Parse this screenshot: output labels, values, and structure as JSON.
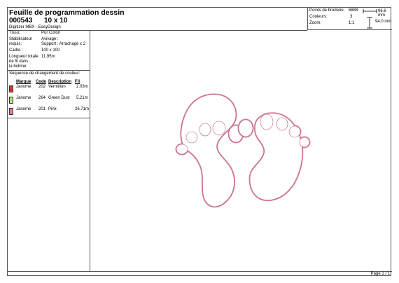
{
  "header": {
    "title": "Feuille de programmation dessin",
    "design_code": "000543",
    "design_size": "10 x 10",
    "software": "Digitizer MBX - EasyDesign"
  },
  "stats": {
    "stitches_label": "Points de broderie:",
    "stitches_value": "6888",
    "colors_label": "Couleurs:",
    "colors_value": "3",
    "zoom_label": "Zoom:",
    "zoom_value": "1:1",
    "width": "96.6 mm",
    "height": "94.0 mm"
  },
  "properties": {
    "fabric_label": "Tissu:",
    "fabric_value": "Pur Coton",
    "stabilizer_label_1": "Stabilisateur",
    "stabilizer_label_2": "requis:",
    "stabilizer_value_1": "Avivage :",
    "stabilizer_value_2": "Support : Arrachage x 2",
    "frame_label": "Cadre :",
    "frame_value": "100 x 100",
    "thread_label_1": "Longueur totale",
    "thread_label_2": "de fil dans",
    "thread_label_3": "la bobine:",
    "thread_value": "11.95m"
  },
  "sequence": {
    "title": "Séquence de changement de couleur:",
    "headers": {
      "brand": "Marque",
      "code": "Code",
      "description": "Description",
      "length": "Fil"
    },
    "rows": [
      {
        "brand": "Janome",
        "code": "202",
        "description": "Vermilion",
        "length": "2.03m",
        "color": "#d9342b"
      },
      {
        "brand": "Janome",
        "code": "264",
        "description": "Green Dust",
        "length": "5.21m",
        "color": "#b9e07a"
      },
      {
        "brand": "Janome",
        "code": "201",
        "description": "Pink",
        "length": "26.71m",
        "color": "#e87aa6"
      }
    ]
  },
  "design": {
    "outline_color": "#d97b9c",
    "fill_color": "#ffffff"
  },
  "footer": {
    "page": "Page 1 / 1"
  }
}
